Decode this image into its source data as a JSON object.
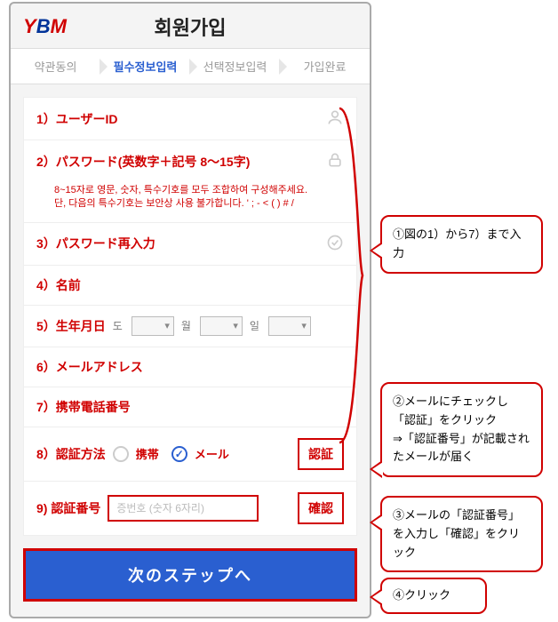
{
  "header": {
    "title": "회원가입",
    "logo": {
      "y": "Y",
      "b": "B",
      "m": "M"
    }
  },
  "steps": {
    "s1": "약관동의",
    "s2": "필수정보입력",
    "s3": "선택정보입력",
    "s4": "가입완료"
  },
  "form": {
    "user_id": "1）ユーザーID",
    "password": "2）パスワード(英数字＋記号 8～15字)",
    "password_hint": "8~15자로 영문, 숫자, 특수기호를 모두 조합하여 구성해주세요.\n단, 다음의 특수기호는 보안상 사용 불가합니다. ' ; - < ( ) # /",
    "password_confirm": "3）パスワード再入力",
    "name": "4）名前",
    "birth": "5）生年月日",
    "birth_year": "도",
    "birth_month": "월",
    "birth_day": "일",
    "email": "6）メールアドレス",
    "phone": "7）携帯電話番号",
    "verify_method": "8）認証方法",
    "opt_phone": "携帯",
    "opt_email": "メール",
    "verify_btn": "認証",
    "verify_code": "9) 認証番号",
    "verify_code_ph": "증번호 (숫자 6자리)",
    "confirm_btn": "確認"
  },
  "next": "次のステップへ",
  "callouts": {
    "c1": "①図の1）から7）まで入力",
    "c2": "②メールにチェックし「認証」をクリック\n⇒「認証番号」が記載されたメールが届く",
    "c3": "③メールの「認証番号」を入力し「確認」をクリック",
    "c4": "④クリック"
  }
}
